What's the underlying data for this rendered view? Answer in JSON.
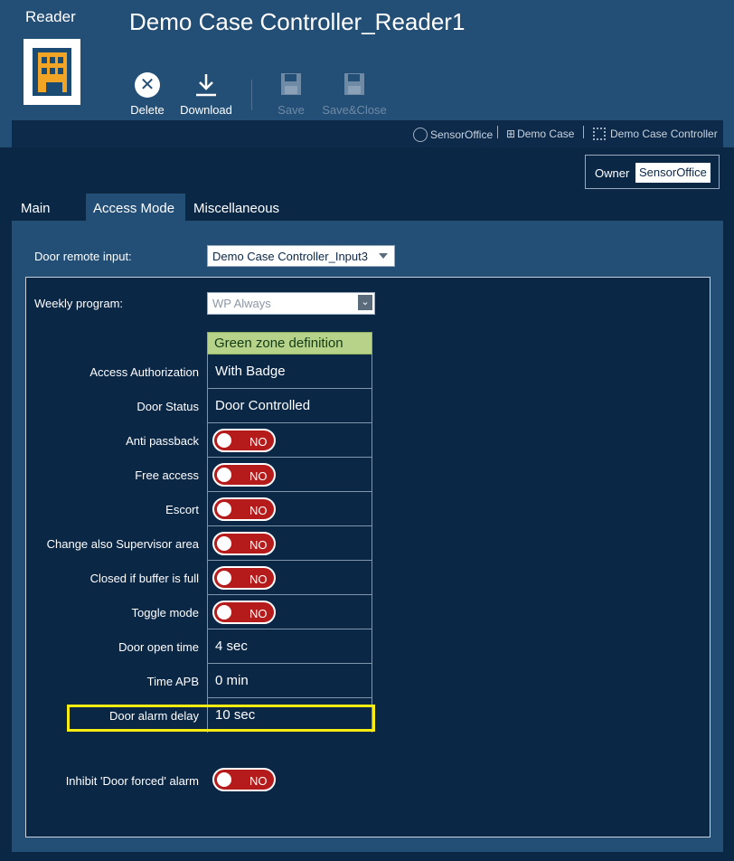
{
  "app": {
    "type_label": "Reader",
    "title": "Demo Case Controller_Reader1"
  },
  "toolbar": {
    "delete": "Delete",
    "download": "Download",
    "save": "Save",
    "save_close": "Save&Close"
  },
  "breadcrumb": [
    "SensorOffice",
    "Demo Case",
    "Demo Case Controller"
  ],
  "owner": {
    "label": "Owner",
    "value": "SensorOffice"
  },
  "tabs": [
    "Main",
    "Access Mode",
    "Miscellaneous"
  ],
  "form": {
    "door_remote_input_label": "Door remote input:",
    "door_remote_input_value": "Demo Case Controller_Input3",
    "weekly_program_label": "Weekly program:",
    "weekly_program_value": "WP Always",
    "zone_header": "Green zone definition",
    "rows": [
      {
        "label": "Access Authorization",
        "value": "With Badge"
      },
      {
        "label": "Door Status",
        "value": "Door Controlled"
      },
      {
        "label": "Anti passback",
        "toggle": "NO"
      },
      {
        "label": "Free access",
        "toggle": "NO"
      },
      {
        "label": "Escort",
        "toggle": "NO"
      },
      {
        "label": "Change also Supervisor area",
        "toggle": "NO"
      },
      {
        "label": "Closed if buffer is full",
        "toggle": "NO"
      },
      {
        "label": "Toggle mode",
        "toggle": "NO"
      },
      {
        "label": "Door open time",
        "value": "4 sec"
      },
      {
        "label": "Time APB",
        "value": "0 min"
      },
      {
        "label": "Door alarm delay",
        "value": "10 sec"
      }
    ],
    "inhibit_label": "Inhibit 'Door forced' alarm",
    "inhibit_toggle": "NO"
  },
  "colors": {
    "toggle_off": "#b61b1b",
    "zone_header": "#b7d38a",
    "highlight": "#f8ec12"
  }
}
